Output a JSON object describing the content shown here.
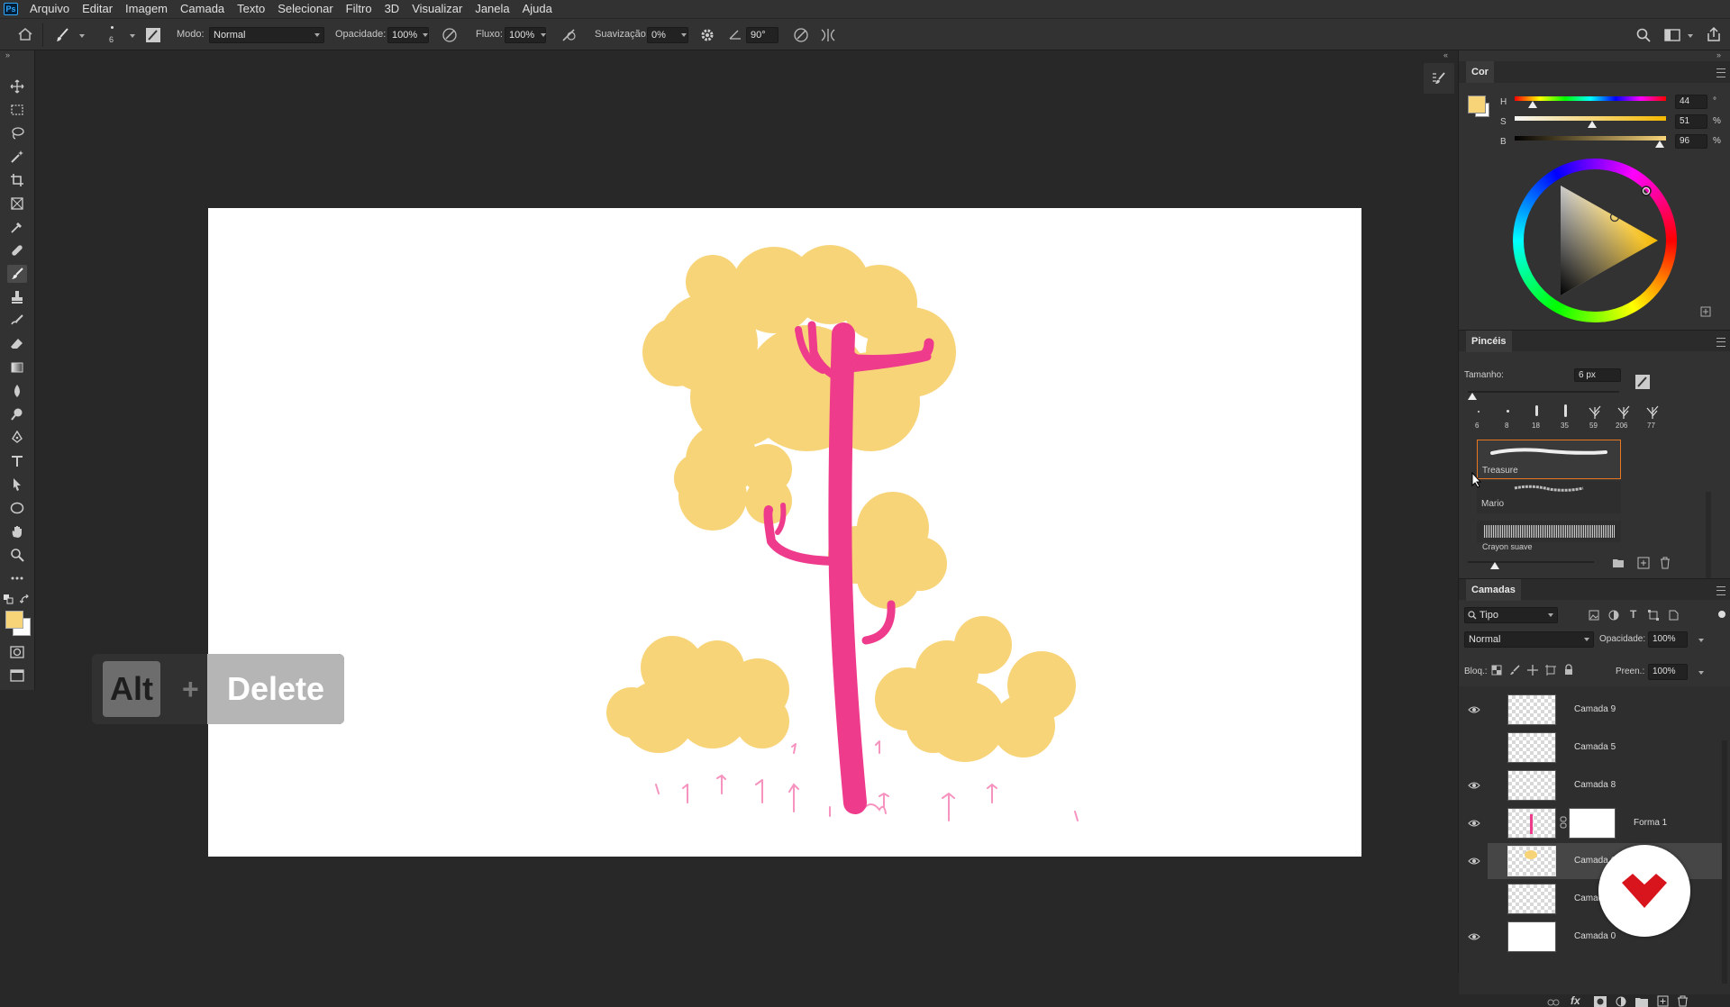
{
  "menu": {
    "logo": "Ps",
    "items": [
      "Arquivo",
      "Editar",
      "Imagem",
      "Camada",
      "Texto",
      "Selecionar",
      "Filtro",
      "3D",
      "Visualizar",
      "Janela",
      "Ajuda"
    ]
  },
  "options": {
    "brush_size": "6",
    "mode_label": "Modo:",
    "mode_value": "Normal",
    "opacity_label": "Opacidade:",
    "opacity_value": "100%",
    "flow_label": "Fluxo:",
    "flow_value": "100%",
    "smoothing_label": "Suavização:",
    "smoothing_value": "0%",
    "angle_value": "90°"
  },
  "colors": {
    "foreground": "#f8d479",
    "background": "#ffffff",
    "tree_pink": "#ef3b8c",
    "foliage": "#f8d479",
    "accent_orange": "#e87722",
    "logo_red": "#d8141c"
  },
  "key_overlay": {
    "key1": "Alt",
    "plus": "+",
    "key2": "Delete"
  },
  "color_panel": {
    "tab": "Cor",
    "h_label": "H",
    "s_label": "S",
    "b_label": "B",
    "h_value": "44",
    "s_value": "51",
    "b_value": "96",
    "h_unit": "°",
    "s_unit": "%",
    "b_unit": "%",
    "h_level": 0.12,
    "s_level": 0.51,
    "b_level": 0.96
  },
  "brushes_panel": {
    "tab": "Pincéis",
    "size_label": "Tamanho:",
    "size_value": "6 px",
    "presets": [
      "6",
      "8",
      "18",
      "35",
      "59",
      "206",
      "77"
    ],
    "brush_list": [
      "Treasure",
      "Mario",
      "Crayon suave"
    ]
  },
  "layers_panel": {
    "tab": "Camadas",
    "filter_label": "Tipo",
    "blend_mode": "Normal",
    "opacity_label": "Opacidade:",
    "opacity_value": "100%",
    "lock_label": "Bloq.:",
    "fill_label": "Preen.:",
    "fill_value": "100%",
    "layers": [
      {
        "name": "Camada 9",
        "visible": true
      },
      {
        "name": "Camada 5",
        "visible": false
      },
      {
        "name": "Camada 8",
        "visible": true
      },
      {
        "name": "Forma 1",
        "visible": true
      },
      {
        "name": "Camada 6",
        "visible": true,
        "selected": true
      },
      {
        "name": "Camada 1",
        "visible": false
      },
      {
        "name": "Camada 0",
        "visible": true
      }
    ]
  }
}
